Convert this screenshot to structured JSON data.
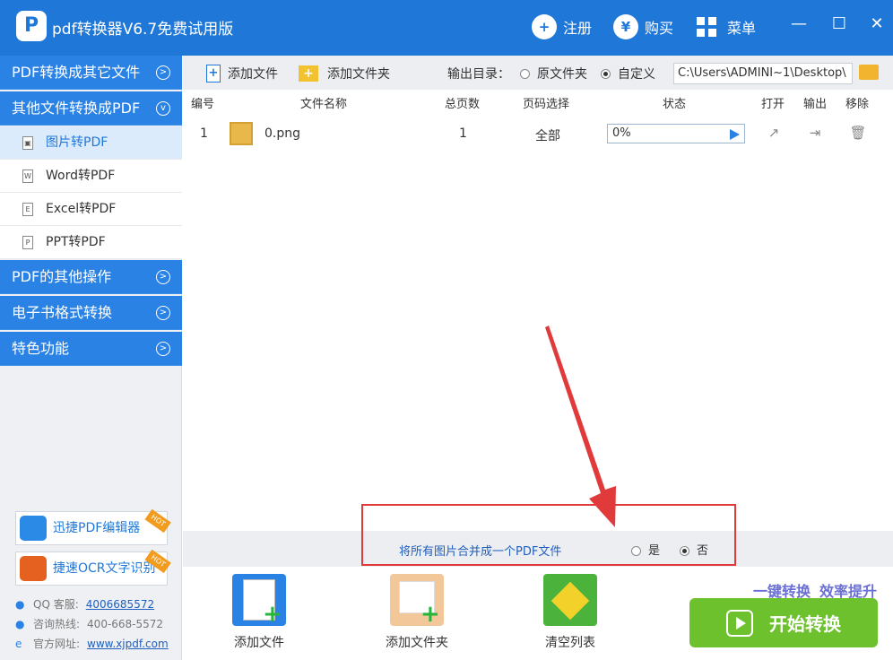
{
  "titlebar": {
    "app_title": "pdf转换器V6.7免费试用版",
    "logo_letter": "P",
    "register_label": "注册",
    "buy_label": "购买",
    "menu_label": "菜单",
    "user_icon": "user-icon",
    "yen_icon": "yen-icon",
    "buy_icon_glyph": "¥",
    "register_icon_glyph": "+",
    "minimize_glyph": "—",
    "maximize_glyph": "☐",
    "close_glyph": "✕",
    "bg_color": "#1f78d8"
  },
  "sidebar": {
    "categories": [
      {
        "label": "PDF转换成其它文件",
        "arrow": ">"
      },
      {
        "label": "其他文件转换成PDF",
        "arrow": "v"
      },
      {
        "label": "PDF的其他操作",
        "arrow": ">"
      },
      {
        "label": "电子书格式转换",
        "arrow": ">"
      },
      {
        "label": "特色功能",
        "arrow": ">"
      }
    ],
    "sub_items": [
      {
        "label": "图片转PDF",
        "icon": "image-file-icon",
        "glyph": "▣"
      },
      {
        "label": "Word转PDF",
        "icon": "word-file-icon",
        "glyph": "W"
      },
      {
        "label": "Excel转PDF",
        "icon": "excel-file-icon",
        "glyph": "E"
      },
      {
        "label": "PPT转PDF",
        "icon": "ppt-file-icon",
        "glyph": "P"
      }
    ],
    "promos": [
      {
        "label": "迅捷PDF编辑器",
        "badge": "HOT"
      },
      {
        "label": "捷速OCR文字识别",
        "badge": "HOT"
      }
    ],
    "contacts": [
      {
        "label": "QQ 客服:",
        "value": "4006685572"
      },
      {
        "label": "咨询热线:",
        "value": "400-668-5572"
      },
      {
        "label": "官方网址:",
        "value": "www.xjpdf.com"
      }
    ],
    "active_color": "#2a82e4"
  },
  "toolbar": {
    "add_file": "添加文件",
    "add_folder": "添加文件夹",
    "output_dir_label": "输出目录：",
    "option_original": "原文件夹",
    "option_custom": "自定义",
    "path_value": "C:\\Users\\ADMINI~1\\Desktop\\"
  },
  "table": {
    "headers": [
      "编号",
      "文件名称",
      "总页数",
      "页码选择",
      "状态",
      "打开",
      "输出",
      "移除"
    ],
    "rows": [
      {
        "index": "1",
        "filename": "0.png",
        "pages": "1",
        "page_select": "全部",
        "status": "0%"
      }
    ]
  },
  "merge": {
    "label": "将所有图片合并成一个PDF文件",
    "yes": "是",
    "no": "否",
    "selected": "否"
  },
  "bottom": {
    "add_file": "添加文件",
    "add_folder": "添加文件夹",
    "clear_list": "清空列表",
    "slogan1": "一键转换",
    "slogan2": "效率提升",
    "start": "开始转换",
    "start_color": "#6cc12d"
  },
  "annotation_color": "#e03a3a"
}
